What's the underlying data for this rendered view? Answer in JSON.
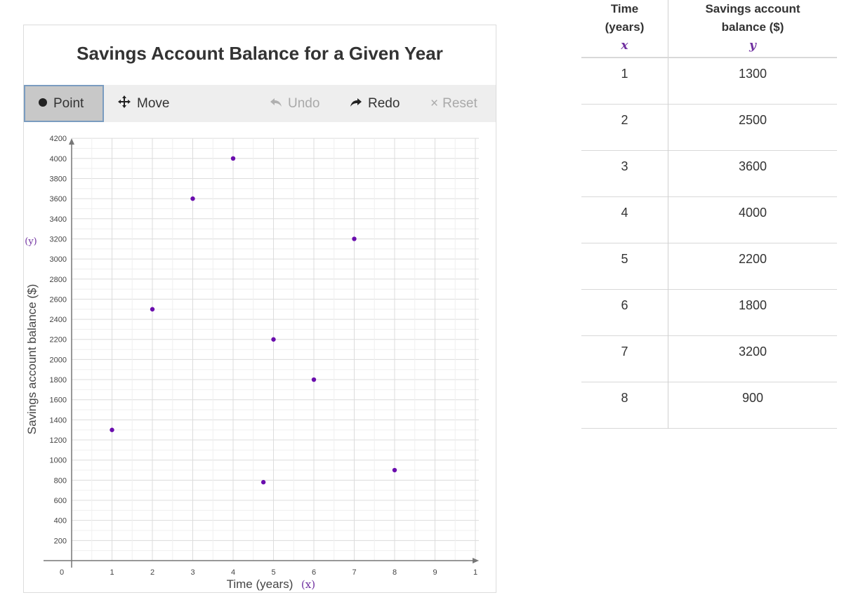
{
  "chart_panel": {
    "title": "Savings Account Balance for a Given Year",
    "toolbar": {
      "point": "Point",
      "move": "Move",
      "undo": "Undo",
      "redo": "Redo",
      "reset": "Reset"
    }
  },
  "chart_data": {
    "type": "scatter",
    "xlabel": "Time (years)",
    "ylabel": "Savings account balance ($)",
    "xlim": [
      0,
      10
    ],
    "ylim": [
      0,
      4200
    ],
    "x_ticks": [
      "0",
      "1",
      "2",
      "3",
      "4",
      "5",
      "6",
      "7",
      "8",
      "9",
      "1"
    ],
    "y_ticks": [
      "200",
      "400",
      "600",
      "800",
      "1000",
      "1200",
      "1400",
      "1600",
      "1800",
      "2000",
      "2200",
      "2400",
      "2600",
      "2800",
      "3000",
      "3200",
      "3400",
      "3600",
      "3800",
      "4000",
      "4200"
    ],
    "grid": true,
    "point_color": "#6a0dad",
    "points": [
      {
        "x": 1,
        "y": 1300
      },
      {
        "x": 2,
        "y": 2500
      },
      {
        "x": 3,
        "y": 3600
      },
      {
        "x": 4,
        "y": 4000
      },
      {
        "x": 4.75,
        "y": 780
      },
      {
        "x": 5,
        "y": 2200
      },
      {
        "x": 6,
        "y": 1800
      },
      {
        "x": 7,
        "y": 3200
      },
      {
        "x": 8,
        "y": 900
      }
    ],
    "annotations": {
      "y_mark": "(y)",
      "x_mark": "(x)"
    }
  },
  "table": {
    "headers": [
      "Time (years)",
      "Savings account balance ($)"
    ],
    "header_notes": [
      "x",
      "y"
    ],
    "rows": [
      [
        "1",
        "1300"
      ],
      [
        "2",
        "2500"
      ],
      [
        "3",
        "3600"
      ],
      [
        "4",
        "4000"
      ],
      [
        "5",
        "2200"
      ],
      [
        "6",
        "1800"
      ],
      [
        "7",
        "3200"
      ],
      [
        "8",
        "900"
      ]
    ]
  },
  "colors": {
    "annotation": "#7030a0",
    "point": "#6a0dad",
    "grid": "#e3e3e3"
  }
}
